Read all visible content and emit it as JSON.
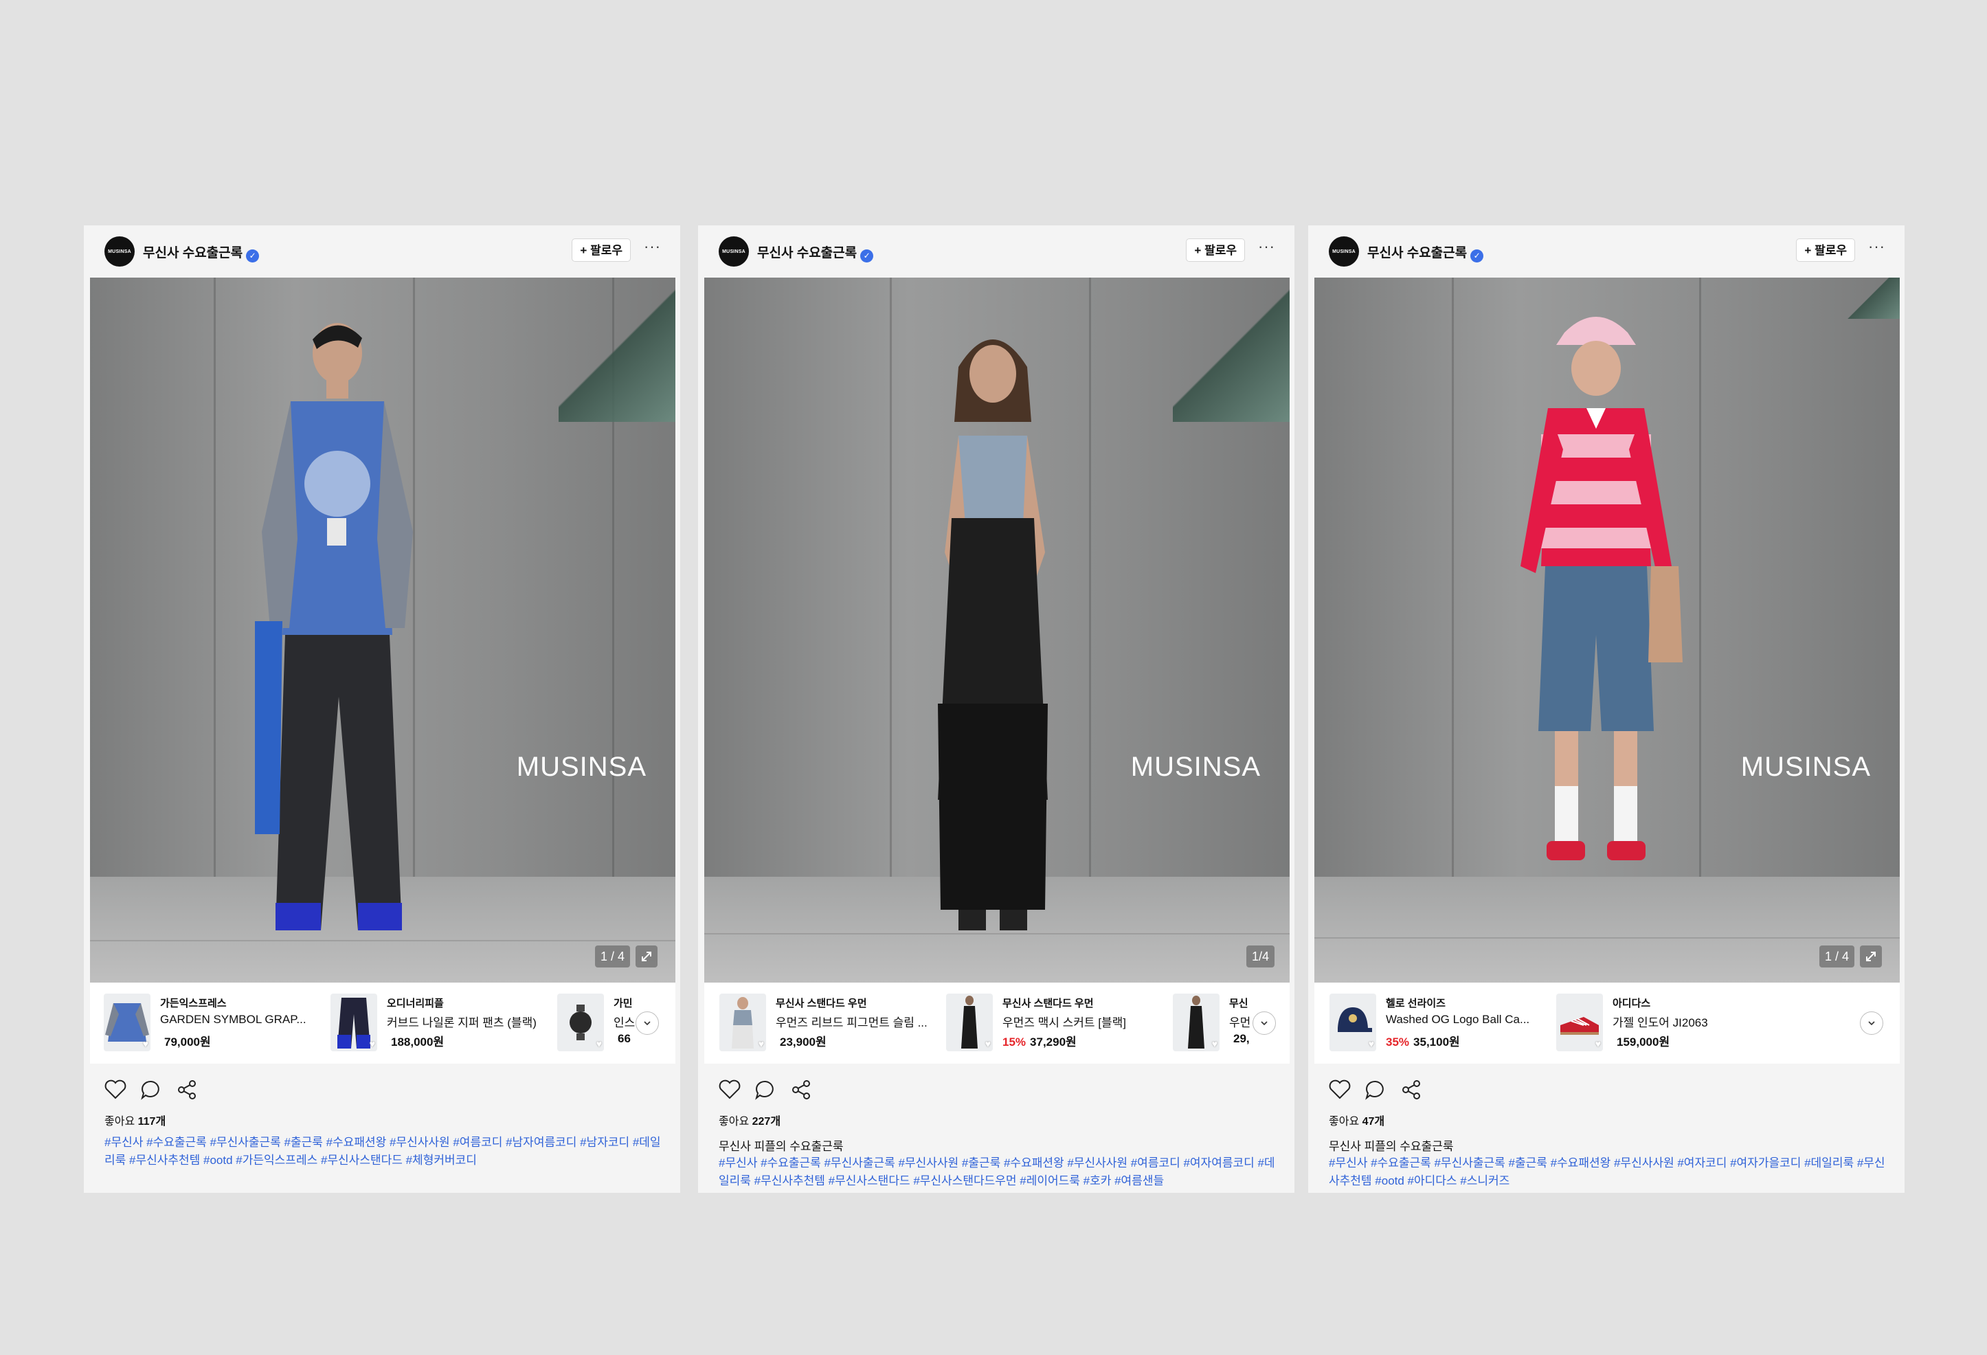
{
  "posts": [
    {
      "account": "무신사 수요출근록",
      "avatar_text": "MUSINSA",
      "follow_label": "+ 팔로우",
      "more_label": "···",
      "watermark": "MUSINSA",
      "counter": "1 / 4",
      "products": [
        {
          "brand": "가든익스프레스",
          "name": "GARDEN SYMBOL GRAP...",
          "discount": "",
          "price": "79,000원"
        },
        {
          "brand": "오디너리피플",
          "name": "커브드 나일론 지퍼 팬츠 (블랙)",
          "discount": "",
          "price": "188,000원"
        },
        {
          "brand": "가민",
          "name": "인스",
          "discount": "",
          "price": "66"
        }
      ],
      "likes_label": "좋아요",
      "likes_count": "117개",
      "caption": "",
      "hashtags": "#무신사 #수요출근록 #무신사출근록 #출근룩 #수요패션왕 #무신사사원 #여름코디 #남자여름코디 #남자코디 #데일리룩 #무신사추천템 #ootd #가든익스프레스 #무신사스탠다드 #체형커버코디"
    },
    {
      "account": "무신사 수요출근록",
      "avatar_text": "MUSINSA",
      "follow_label": "+ 팔로우",
      "more_label": "···",
      "watermark": "MUSINSA",
      "counter": "1/4",
      "products": [
        {
          "brand": "무신사 스탠다드 우먼",
          "name": "우먼즈 리브드 피그먼트 슬림 ...",
          "discount": "",
          "price": "23,900원"
        },
        {
          "brand": "무신사 스탠다드 우먼",
          "name": "우먼즈 맥시 스커트 [블랙]",
          "discount": "15%",
          "price": "37,290원"
        },
        {
          "brand": "무신",
          "name": "우먼",
          "discount": "",
          "price": "29,"
        }
      ],
      "likes_label": "좋아요",
      "likes_count": "227개",
      "caption": "무신사 피플의 수요출근룩",
      "hashtags": "#무신사 #수요출근록 #무신사출근록 #무신사사원 #출근룩 #수요패션왕 #무신사사원 #여름코디 #여자여름코디 #데일리룩 #무신사추천템 #무신사스탠다드 #무신사스탠다드우먼 #레이어드룩 #호카 #여름샌들"
    },
    {
      "account": "무신사 수요출근록",
      "avatar_text": "MUSINSA",
      "follow_label": "+ 팔로우",
      "more_label": "···",
      "watermark": "MUSINSA",
      "counter": "1 / 4",
      "products": [
        {
          "brand": "헬로 선라이즈",
          "name": "Washed OG Logo Ball Ca...",
          "discount": "35%",
          "price": "35,100원"
        },
        {
          "brand": "아디다스",
          "name": "가젤 인도어 JI2063",
          "discount": "",
          "price": "159,000원"
        }
      ],
      "likes_label": "좋아요",
      "likes_count": "47개",
      "caption": "무신사 피플의 수요출근룩",
      "hashtags": "#무신사 #수요출근록 #무신사출근록 #출근룩 #수요패션왕 #무신사사원 #여자코디 #여자가을코디 #데일리룩 #무신사추천템 #ootd #아디다스 #스니커즈"
    }
  ],
  "colors": {
    "hashtag": "#2f62d8",
    "discount": "#e5252a",
    "verified": "#3b6fe8",
    "background": "#e2e2e2"
  },
  "icons": [
    "verified-icon",
    "heart-icon",
    "comment-icon",
    "share-icon",
    "chevron-down-icon",
    "expand-icon"
  ]
}
